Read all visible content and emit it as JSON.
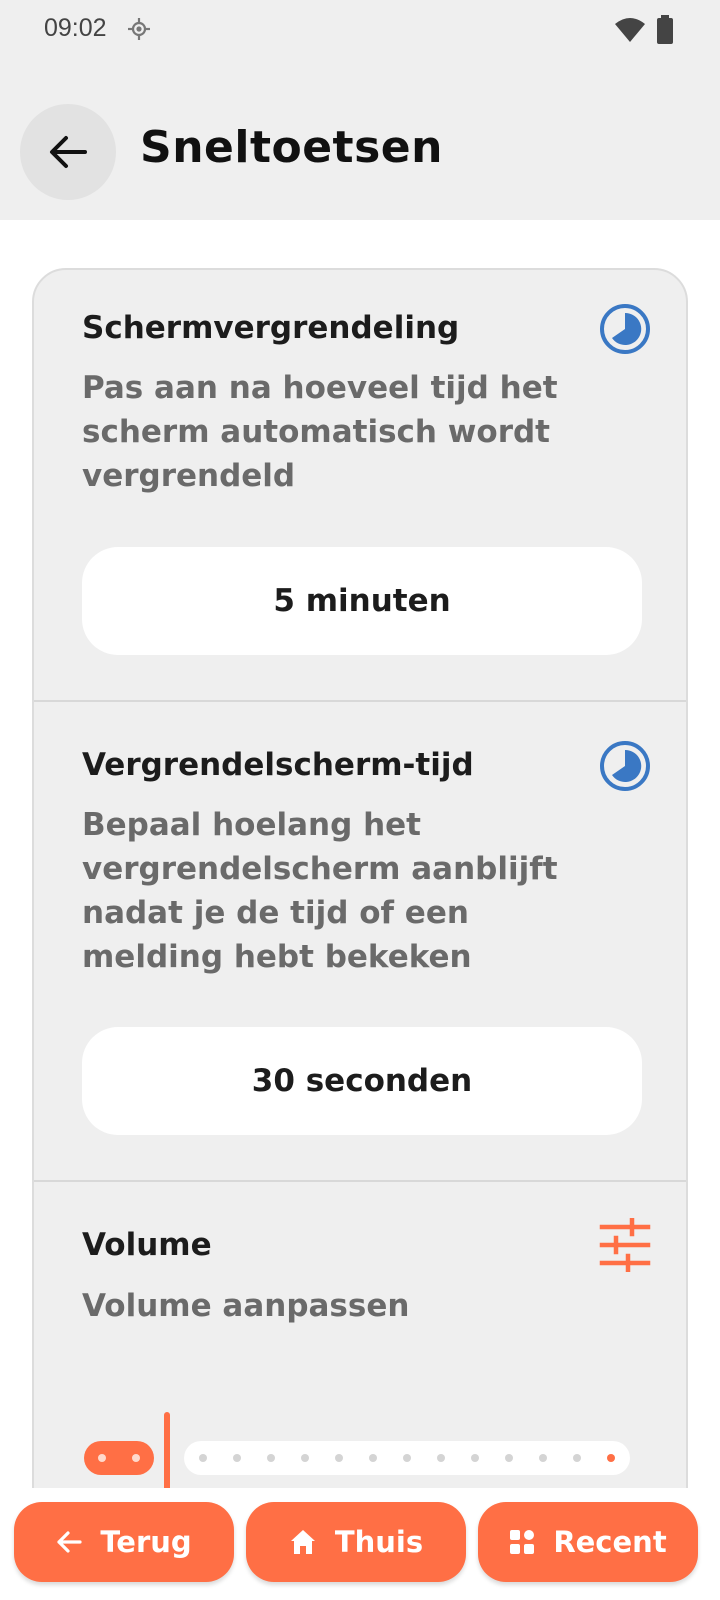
{
  "status_bar": {
    "time": "09:02",
    "icons": [
      "location-icon",
      "wifi-icon",
      "battery-icon"
    ]
  },
  "app_bar": {
    "title": "Sneltoetsen",
    "back_icon": "arrow-left-icon"
  },
  "sections": [
    {
      "title": "Schermvergrendeling",
      "description": "Pas aan na hoeveel tijd het scherm automatisch wordt vergrendeld",
      "icon": "timer-icon",
      "value": "5 minuten"
    },
    {
      "title": "Vergrendelscherm-tijd",
      "description": "Bepaal hoelang het vergrendelscherm aanblijft nadat je de tijd of een melding hebt bekeken",
      "icon": "timer-icon",
      "value": "30 seconden"
    },
    {
      "title": "Volume",
      "description": "Volume aanpassen",
      "icon": "sliders-icon",
      "slider_level": 0.07
    }
  ],
  "bottom_nav": {
    "back_label": "Terug",
    "home_label": "Thuis",
    "recent_label": "Recent"
  },
  "colors": {
    "accent": "#ff6f45",
    "timer_icon": "#3a78c4",
    "background": "#efefef"
  }
}
